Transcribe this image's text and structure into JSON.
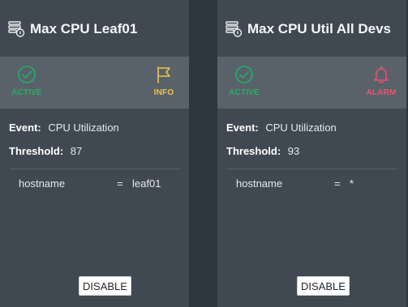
{
  "cards": [
    {
      "title": "Max CPU Leaf01",
      "status_left": {
        "label": "ACTIVE",
        "icon": "check-circle-icon",
        "color": "#27ae60"
      },
      "status_right": {
        "label": "INFO",
        "icon": "flag-icon",
        "color": "#f2c14e"
      },
      "event_key": "Event:",
      "event_value": "CPU Utilization",
      "threshold_key": "Threshold:",
      "threshold_value": "87",
      "condition": {
        "field": "hostname",
        "operator": "=",
        "value": "leaf01"
      },
      "disable_label": "DISABLE"
    },
    {
      "title": "Max CPU Util All Devs",
      "status_left": {
        "label": "ACTIVE",
        "icon": "check-circle-icon",
        "color": "#27ae60"
      },
      "status_right": {
        "label": "ALARM",
        "icon": "bell-icon",
        "color": "#e8536d"
      },
      "event_key": "Event:",
      "event_value": "CPU Utilization",
      "threshold_key": "Threshold:",
      "threshold_value": "93",
      "condition": {
        "field": "hostname",
        "operator": "=",
        "value": "*"
      },
      "disable_label": "DISABLE"
    }
  ]
}
